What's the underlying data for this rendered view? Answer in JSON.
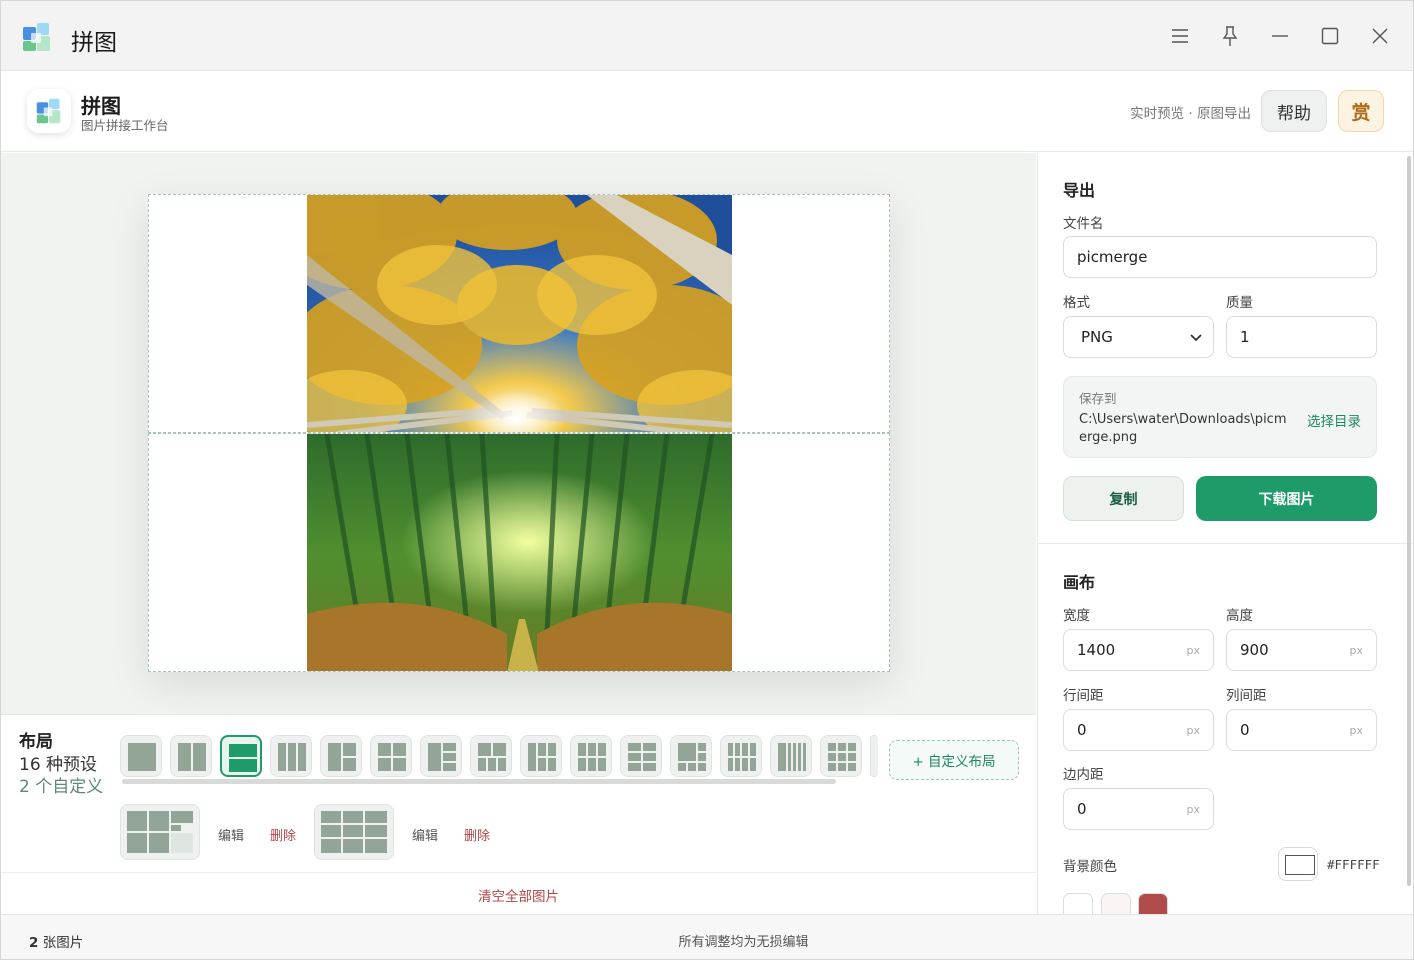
{
  "window": {
    "title": "拼图",
    "controls": [
      "menu-icon",
      "pin-icon",
      "minimize-icon",
      "maximize-icon",
      "close-icon"
    ]
  },
  "header": {
    "app_name": "拼图",
    "subtitle": "图片拼接工作台",
    "note": "实时预览 · 原图导出",
    "help_label": "帮助",
    "reward_label": "赏"
  },
  "layout": {
    "title": "布局",
    "preset_count": "16 种预设",
    "custom_count": "2 个自定义",
    "active_preset": 3,
    "custom_button": "+ 自定义布局",
    "custom_layouts": [
      {
        "edit": "编辑",
        "delete": "删除"
      },
      {
        "edit": "编辑",
        "delete": "删除"
      }
    ],
    "clear_all": "清空全部图片"
  },
  "status": {
    "image_count": "2",
    "image_unit": " 张图片",
    "note": "所有调整均为无损编辑"
  },
  "export": {
    "title": "导出",
    "filename_label": "文件名",
    "filename_value": "picmerge",
    "format_label": "格式",
    "format_value": "PNG",
    "quality_label": "质量",
    "quality_value": "1",
    "save_label": "保存到",
    "save_path": "C:\\Users\\water\\Downloads\\picmerge.png",
    "choose_dir": "选择目录",
    "copy_label": "复制",
    "download_label": "下载图片"
  },
  "canvas": {
    "title": "画布",
    "width_label": "宽度",
    "width_value": "1400",
    "height_label": "高度",
    "height_value": "900",
    "row_gap_label": "行间距",
    "row_gap_value": "0",
    "col_gap_label": "列间距",
    "col_gap_value": "0",
    "padding_label": "边内距",
    "padding_value": "0",
    "unit": "px",
    "bg_label": "背景颜色",
    "bg_value": "#FFFFFF",
    "preset_colors": [
      "#ffffff",
      "#faf5f3",
      "#b04b4b"
    ]
  }
}
